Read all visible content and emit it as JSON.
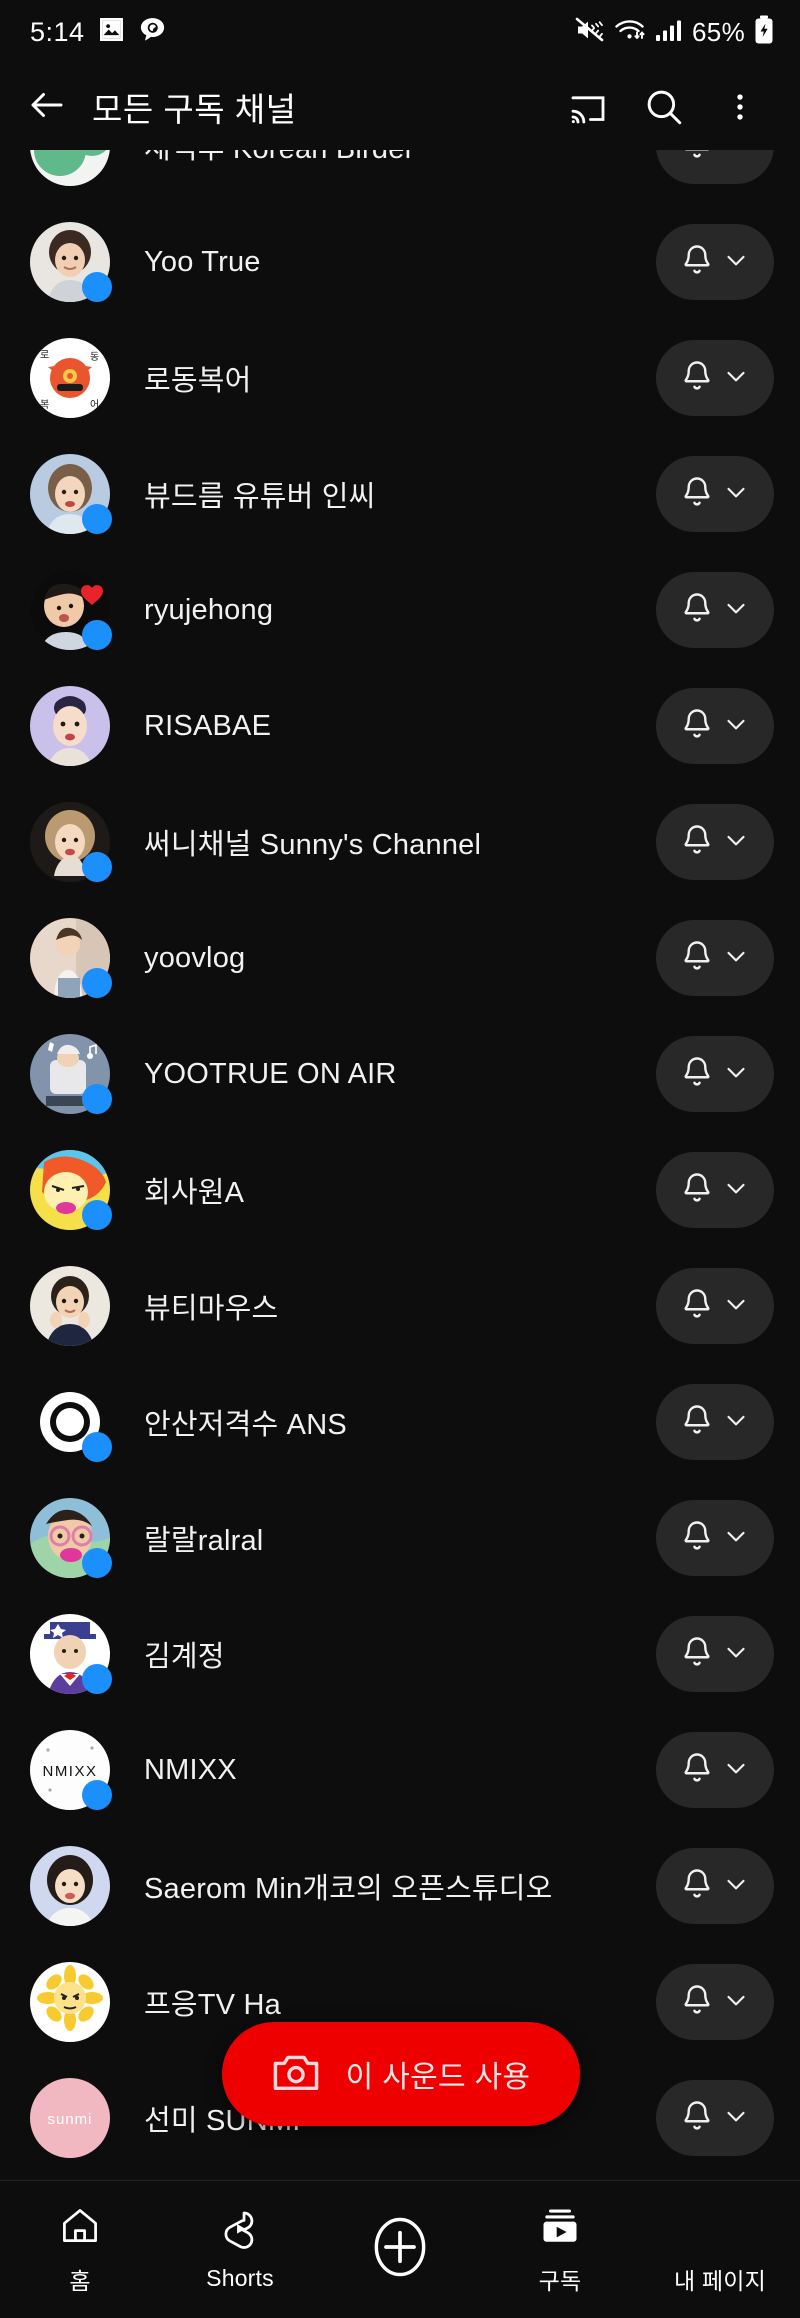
{
  "status_bar": {
    "time": "5:14",
    "battery_percent": "65%",
    "left_icons": [
      "photo-icon",
      "kakaotalk-icon"
    ],
    "right_icons": [
      "mute-icon",
      "wifi-icon",
      "signal-icon",
      "battery-charging-icon"
    ]
  },
  "app_bar": {
    "back_icon": "back-arrow-icon",
    "title": "모든 구독 채널",
    "actions": [
      {
        "icon": "cast-icon"
      },
      {
        "icon": "search-icon"
      },
      {
        "icon": "more-vertical-icon"
      }
    ]
  },
  "colors": {
    "background": "#0d0d0d",
    "accent_red": "#ee0000",
    "live_badge_blue": "#1b8ffb",
    "bell_button_bg": "#282828",
    "text_primary": "#f1f1f1"
  },
  "subscriptions": {
    "bell_icon": "bell-icon",
    "chevron_icon": "chevron-down-icon",
    "items": [
      {
        "name": "새덕후 Korean Birder",
        "live_badge": false,
        "partial": true,
        "avatar": "bird-globe"
      },
      {
        "name": "Yoo True",
        "live_badge": true,
        "avatar": "woman-a"
      },
      {
        "name": "로동복어",
        "live_badge": false,
        "avatar": "pufferfish"
      },
      {
        "name": "뷰드름 유튜버 인씨",
        "live_badge": true,
        "avatar": "woman-b"
      },
      {
        "name": "ryujehong",
        "live_badge": true,
        "avatar": "man-heart"
      },
      {
        "name": "RISABAE",
        "live_badge": false,
        "avatar": "woman-c"
      },
      {
        "name": "써니채널 Sunny's Channel",
        "live_badge": true,
        "avatar": "woman-d"
      },
      {
        "name": "yoovlog",
        "live_badge": true,
        "avatar": "woman-e"
      },
      {
        "name": "YOOTRUE ON AIR",
        "live_badge": true,
        "avatar": "music-man"
      },
      {
        "name": "회사원A",
        "live_badge": true,
        "avatar": "cartoon-face"
      },
      {
        "name": "뷰티마우스",
        "live_badge": false,
        "avatar": "woman-f"
      },
      {
        "name": "안산저격수 ANS",
        "live_badge": true,
        "avatar": "ring-logo"
      },
      {
        "name": "랄랄ralral",
        "live_badge": true,
        "avatar": "glasses-woman"
      },
      {
        "name": "김계정",
        "live_badge": true,
        "avatar": "hat-man"
      },
      {
        "name": "NMIXX",
        "live_badge": true,
        "avatar": "nmixx-logo"
      },
      {
        "name": "Saerom Min개코의 오픈스튜디오",
        "live_badge": false,
        "avatar": "woman-g"
      },
      {
        "name": "프응TV Ha",
        "live_badge": false,
        "avatar": "sunflower"
      },
      {
        "name": "선미 SUNMI",
        "live_badge": false,
        "avatar": "sunmi-logo"
      }
    ]
  },
  "floating_cta": {
    "icon": "camera-icon",
    "label": "이 사운드 사용"
  },
  "bottom_nav": {
    "items": [
      {
        "label": "홈",
        "icon": "home-icon",
        "active": false
      },
      {
        "label": "Shorts",
        "icon": "shorts-icon",
        "active": false
      },
      {
        "label": "",
        "icon": "create-plus-icon",
        "active": false
      },
      {
        "label": "구독",
        "icon": "subscriptions-icon",
        "active": true
      },
      {
        "label": "내 페이지",
        "icon": "account-icon",
        "active": false
      }
    ]
  }
}
